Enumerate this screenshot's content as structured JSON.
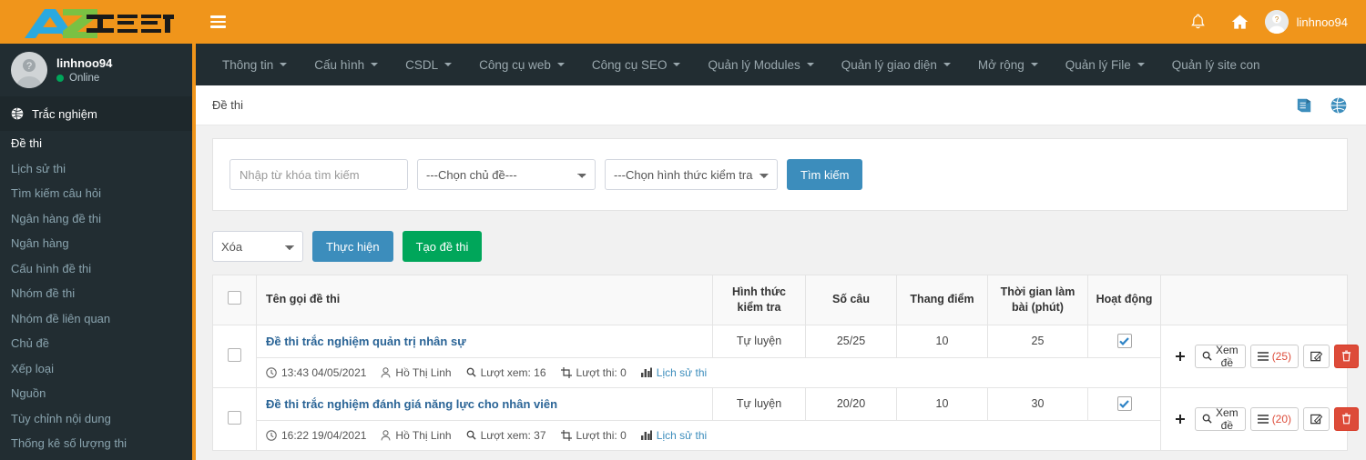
{
  "brand": {
    "logo_text_a": "A",
    "logo_text_z": "Z",
    "logo_text_rest": "TEST"
  },
  "sidebar": {
    "user": {
      "name": "linhnoo94",
      "status": "Online",
      "avatar_icon": "user-placeholder-icon"
    },
    "section": {
      "label": "Trắc nghiệm",
      "icon": "quiz-globe-icon"
    },
    "items": [
      {
        "label": "Đề thi",
        "active": true
      },
      {
        "label": "Lịch sử thi",
        "active": false
      },
      {
        "label": "Tìm kiếm câu hỏi",
        "active": false
      },
      {
        "label": "Ngân hàng đề thi",
        "active": false
      },
      {
        "label": "Ngân hàng",
        "active": false
      },
      {
        "label": "Cấu hình đề thi",
        "active": false
      },
      {
        "label": "Nhóm đề thi",
        "active": false
      },
      {
        "label": "Nhóm đề liên quan",
        "active": false
      },
      {
        "label": "Chủ đề",
        "active": false
      },
      {
        "label": "Xếp loại",
        "active": false
      },
      {
        "label": "Nguồn",
        "active": false
      },
      {
        "label": "Tùy chỉnh nội dung",
        "active": false
      },
      {
        "label": "Thống kê số lượng thi",
        "active": false
      }
    ]
  },
  "topbar": {
    "hamburger_icon": "hamburger-icon",
    "bell_icon": "bell-icon",
    "home_icon": "home-icon",
    "username": "linhnoo94",
    "avatar_icon": "user-placeholder-icon"
  },
  "menubar": {
    "items": [
      {
        "label": "Thông tin",
        "caret": true
      },
      {
        "label": "Cấu hình",
        "caret": true
      },
      {
        "label": "CSDL",
        "caret": true
      },
      {
        "label": "Công cụ web",
        "caret": true
      },
      {
        "label": "Công cụ SEO",
        "caret": true
      },
      {
        "label": "Quản lý Modules",
        "caret": true
      },
      {
        "label": "Quản lý giao diện",
        "caret": true
      },
      {
        "label": "Mở rộng",
        "caret": true
      },
      {
        "label": "Quản lý File",
        "caret": true
      },
      {
        "label": "Quản lý site con",
        "caret": false
      }
    ]
  },
  "breadcrumb": {
    "title": "Đề thi",
    "book_icon": "book-icon",
    "globe_icon": "globe-icon"
  },
  "search": {
    "keyword_value": "",
    "keyword_placeholder": "Nhập từ khóa tìm kiếm",
    "topic_selected": "---Chọn chủ đề---",
    "type_selected": "---Chọn hình thức kiểm tra-",
    "submit_label": "Tìm kiếm"
  },
  "actions": {
    "bulk_selected": "Xóa",
    "execute_label": "Thực hiện",
    "create_label": "Tạo đề thi"
  },
  "table": {
    "headers": {
      "checkbox": "",
      "name": "Tên gọi đề thi",
      "form": "Hình thức kiểm tra",
      "questions": "Số câu",
      "scale": "Thang điểm",
      "duration": "Thời gian làm bài (phút)",
      "active": "Hoạt động",
      "tools": ""
    },
    "rows": [
      {
        "selected": false,
        "title": "Đề thi trắc nghiệm quản trị nhân sự",
        "time": "13:43 04/05/2021",
        "author": "Hồ Thị Linh",
        "views": "Lượt xem: 16",
        "attempts": "Lượt thi: 0",
        "history_link": "Lịch sử thi",
        "form": "Tự luyện",
        "questions": "25/25",
        "scale": "10",
        "duration": "25",
        "active": true,
        "tools": {
          "add_icon": "plus-icon",
          "view_label": "Xem đề",
          "view_icon": "search-icon",
          "list_icon": "list-icon",
          "list_count": "(25)",
          "edit_icon": "edit-icon",
          "delete_icon": "trash-icon"
        }
      },
      {
        "selected": false,
        "title": "Đề thi trắc nghiệm đánh giá năng lực cho nhân viên",
        "time": "16:22 19/04/2021",
        "author": "Hồ Thị Linh",
        "views": "Lượt xem: 37",
        "attempts": "Lượt thi: 0",
        "history_link": "Lịch sử thi",
        "form": "Tự luyện",
        "questions": "20/20",
        "scale": "10",
        "duration": "30",
        "active": true,
        "tools": {
          "add_icon": "plus-icon",
          "view_label": "Xem đề",
          "view_icon": "search-icon",
          "list_icon": "list-icon",
          "list_count": "(20)",
          "edit_icon": "edit-icon",
          "delete_icon": "trash-icon"
        }
      }
    ]
  },
  "colors": {
    "brand_orange": "#f0951b",
    "sidebar_dark": "#222d32",
    "accent_blue": "#3c8dbc",
    "success_green": "#00a65a",
    "danger_red": "#dd4b39"
  }
}
